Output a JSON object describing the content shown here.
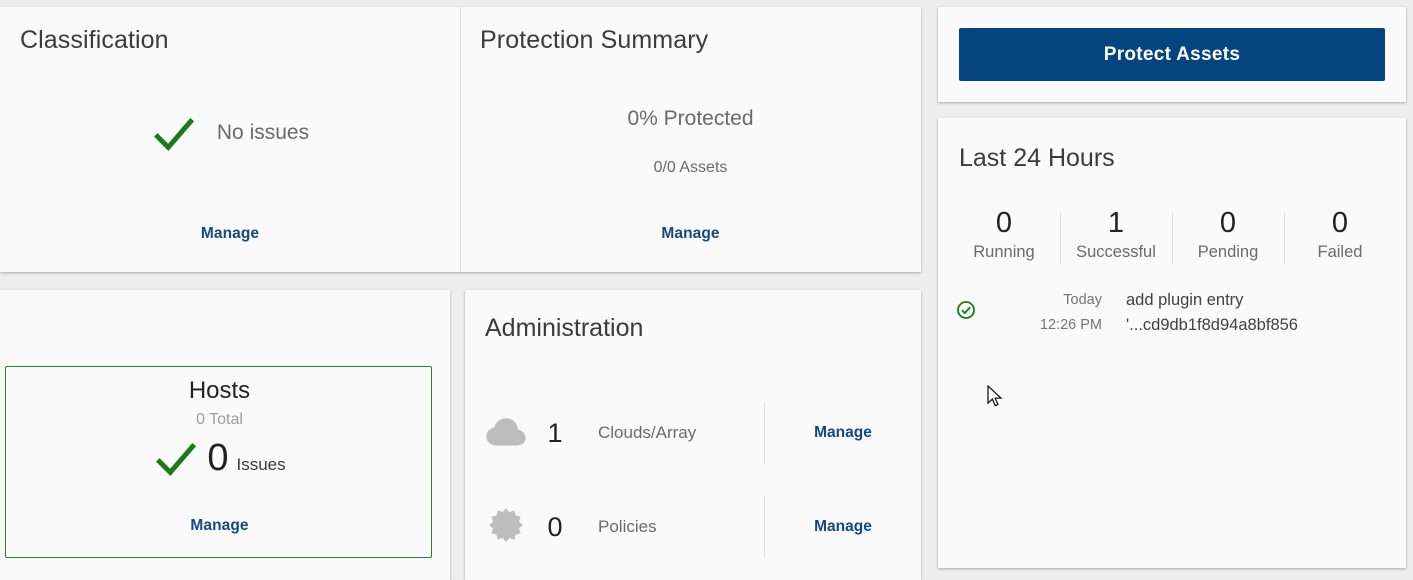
{
  "colors": {
    "accent_link": "#16497c",
    "button_primary": "#05447d",
    "success_green": "#1b7a1b",
    "tile_border_green": "#2e7d32",
    "card_bg": "#fafafa",
    "page_bg": "#eeeeee",
    "icon_gray": "#bdbdbd"
  },
  "classification": {
    "title": "Classification",
    "status_text": "No issues",
    "status_icon": "check-icon",
    "manage_label": "Manage"
  },
  "protection_summary": {
    "title": "Protection Summary",
    "percent_text": "0% Protected",
    "assets_text": "0/0 Assets",
    "manage_label": "Manage"
  },
  "hosts": {
    "title": "Hosts",
    "total_text": "0 Total",
    "issues_count": "0",
    "issues_label": "Issues",
    "status_icon": "check-icon",
    "manage_label": "Manage"
  },
  "administration": {
    "title": "Administration",
    "rows": [
      {
        "icon": "cloud-icon",
        "count": "1",
        "label": "Clouds/Array",
        "manage_label": "Manage"
      },
      {
        "icon": "policy-badge-icon",
        "count": "0",
        "label": "Policies",
        "manage_label": "Manage"
      }
    ]
  },
  "protect": {
    "button_label": "Protect Assets"
  },
  "last_24_hours": {
    "title": "Last 24 Hours",
    "stats": [
      {
        "value": "0",
        "label": "Running"
      },
      {
        "value": "1",
        "label": "Successful"
      },
      {
        "value": "0",
        "label": "Pending"
      },
      {
        "value": "0",
        "label": "Failed"
      }
    ],
    "activity": [
      {
        "status_icon": "check-circle-icon",
        "day": "Today",
        "time": "12:26 PM",
        "title": "add plugin entry",
        "detail": "'...cd9db1f8d94a8bf856"
      }
    ]
  },
  "cursor": {
    "icon": "arrow-pointer-icon"
  }
}
